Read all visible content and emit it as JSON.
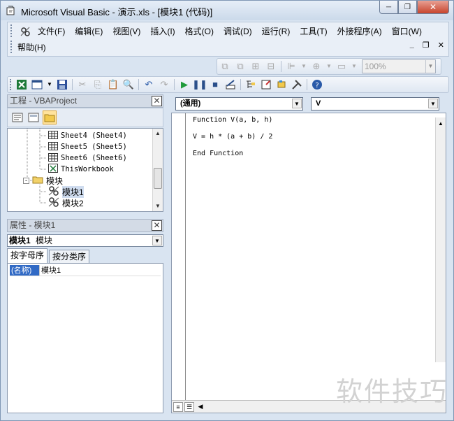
{
  "window": {
    "title": "Microsoft Visual Basic - 演示.xls - [模块1 (代码)]",
    "minimize": "─",
    "restore": "❐",
    "close": "✕",
    "doc_minimize": "_",
    "doc_restore": "❐",
    "doc_close": "✕"
  },
  "menu": {
    "row1": [
      "文件(F)",
      "编辑(E)",
      "视图(V)",
      "插入(I)",
      "格式(O)",
      "调试(D)",
      "运行(R)",
      "工具(T)",
      "外接程序(A)",
      "窗口(W)"
    ],
    "row2": [
      "帮助(H)"
    ]
  },
  "toolbar": {
    "zoom_value": "100%"
  },
  "project_explorer": {
    "title": "工程 - VBAProject",
    "items": [
      {
        "label": "Sheet4 (Sheet4)",
        "icon": "worksheet-icon"
      },
      {
        "label": "Sheet5 (Sheet5)",
        "icon": "worksheet-icon"
      },
      {
        "label": "Sheet6 (Sheet6)",
        "icon": "worksheet-icon"
      },
      {
        "label": "ThisWorkbook",
        "icon": "workbook-icon"
      },
      {
        "label": "模块",
        "icon": "folder-icon"
      },
      {
        "label": "模块1",
        "icon": "module-icon"
      },
      {
        "label": "模块2",
        "icon": "module-icon"
      }
    ]
  },
  "properties": {
    "title": "属性 - 模块1",
    "object_name": "模块1",
    "object_type": "模块",
    "tab_alphabetic": "按字母序",
    "tab_categorized": "按分类序",
    "rows": [
      {
        "key": "(名称)",
        "value": "模块1"
      }
    ]
  },
  "code_window": {
    "object_combo": "(通用)",
    "procedure_combo": "V",
    "lines": [
      "Function V(a, b, h)",
      "V = h * (a + b) / 2",
      "End Function"
    ]
  },
  "watermark": "软件技巧"
}
